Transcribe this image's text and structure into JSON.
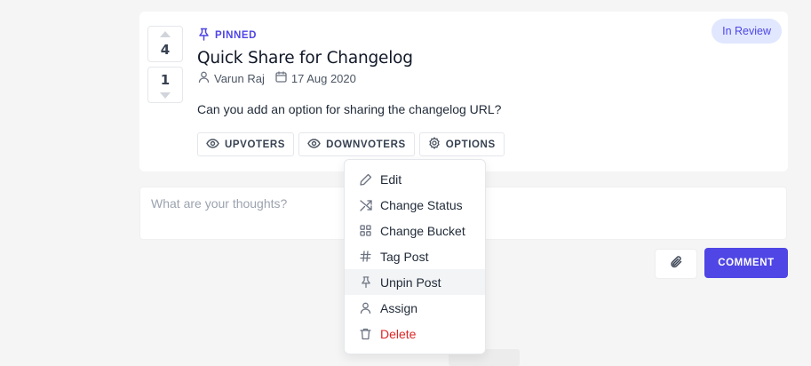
{
  "post": {
    "upvotes": "4",
    "downvotes": "1",
    "pinned_label": "PINNED",
    "title": "Quick Share for Changelog",
    "author": "Varun Raj",
    "date": "17 Aug 2020",
    "body": "Can you add an option for sharing the changelog URL?",
    "status": "In Review"
  },
  "actions": {
    "upvoters": "UPVOTERS",
    "downvoters": "DOWNVOTERS",
    "options": "OPTIONS"
  },
  "options_menu": {
    "items": [
      {
        "label": "Edit",
        "icon": "pencil-icon"
      },
      {
        "label": "Change Status",
        "icon": "shuffle-icon"
      },
      {
        "label": "Change Bucket",
        "icon": "grid-icon"
      },
      {
        "label": "Tag Post",
        "icon": "hashtag-icon"
      },
      {
        "label": "Unpin Post",
        "icon": "pin-icon"
      },
      {
        "label": "Assign",
        "icon": "user-icon"
      },
      {
        "label": "Delete",
        "icon": "trash-icon"
      }
    ]
  },
  "comment": {
    "placeholder": "What are your thoughts?",
    "submit_label": "COMMENT"
  },
  "colors": {
    "accent": "#4f46e5",
    "badge_bg": "#e0e7ff",
    "danger": "#dc2626",
    "page_bg": "#f5f5f5"
  }
}
